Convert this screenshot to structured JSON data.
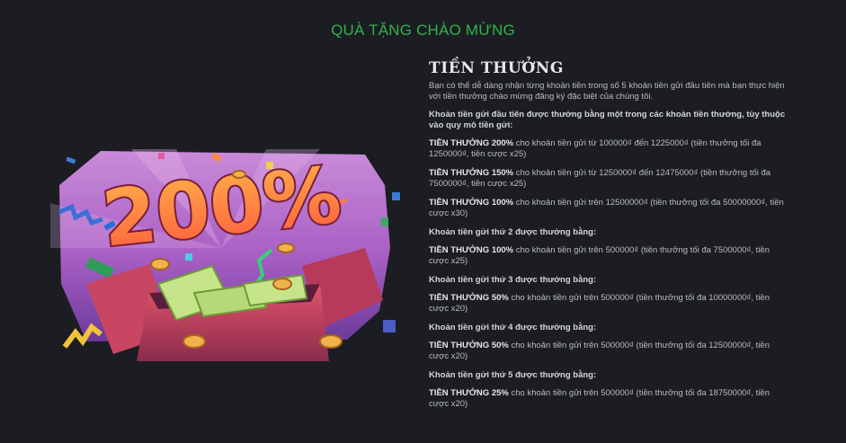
{
  "page_title": "QUÀ TẶNG CHÀO MỪNG",
  "banner": {
    "text": "200%"
  },
  "bonus": {
    "title": "TIỀN THƯỞNG",
    "intro": "Bạn có thể dễ dàng nhận từng khoản tiền trong số 5 khoản tiền gửi đầu tiên mà bạn thực hiện với tiền thưởng chào mừng đăng ký đặc biệt của chúng tôi.",
    "sections": [
      {
        "heading": "Khoản tiền gửi đầu tiên được thưởng bằng một trong các khoản tiền thưởng, tùy thuộc vào quy mô tiền gửi:",
        "tiers": [
          {
            "label": "TIỀN THƯỞNG 200%",
            "text": " cho khoản tiền gửi từ 100000₫ đến 1225000₫ (tiền thưởng tối đa 1250000₫, tiền cược x25)"
          },
          {
            "label": "TIỀN THƯỞNG 150%",
            "text": " cho khoản tiền gửi từ 1250000₫ đến 12475000₫ (tiền thưởng tối đa 7500000₫, tiền cược x25)"
          },
          {
            "label": "TIỀN THƯỞNG 100%",
            "text": " cho khoản tiền gửi trên 12500000₫ (tiền thưởng tối đa 50000000₫, tiền cược x30)"
          }
        ]
      },
      {
        "heading": "Khoản tiền gửi thứ 2 được thưởng bằng:",
        "tiers": [
          {
            "label": "TIỀN THƯỞNG 100%",
            "text": " cho khoản tiền gửi trên 500000₫ (tiền thưởng tối đa 7500000₫, tiền cược x25)"
          }
        ]
      },
      {
        "heading": "Khoản tiền gửi thứ 3 được thưởng bằng:",
        "tiers": [
          {
            "label": "TIỀN THƯỞNG 50%",
            "text": " cho khoản tiền gửi trên 500000₫ (tiền thưởng tối đa 10000000₫, tiền cược x20)"
          }
        ]
      },
      {
        "heading": "Khoản tiền gửi thứ 4 được thưởng bằng:",
        "tiers": [
          {
            "label": "TIỀN THƯỞNG 50%",
            "text": " cho khoản tiền gửi trên 500000₫ (tiền thưởng tối đa 12500000₫, tiền cược x20)"
          }
        ]
      },
      {
        "heading": "Khoản tiền gửi thứ 5 được thưởng bằng:",
        "tiers": [
          {
            "label": "TIỀN THƯỞNG 25%",
            "text": " cho khoản tiền gửi trên 500000₫ (tiền thưởng tối đa 18750000₫, tiền cược x20)"
          }
        ]
      }
    ]
  }
}
